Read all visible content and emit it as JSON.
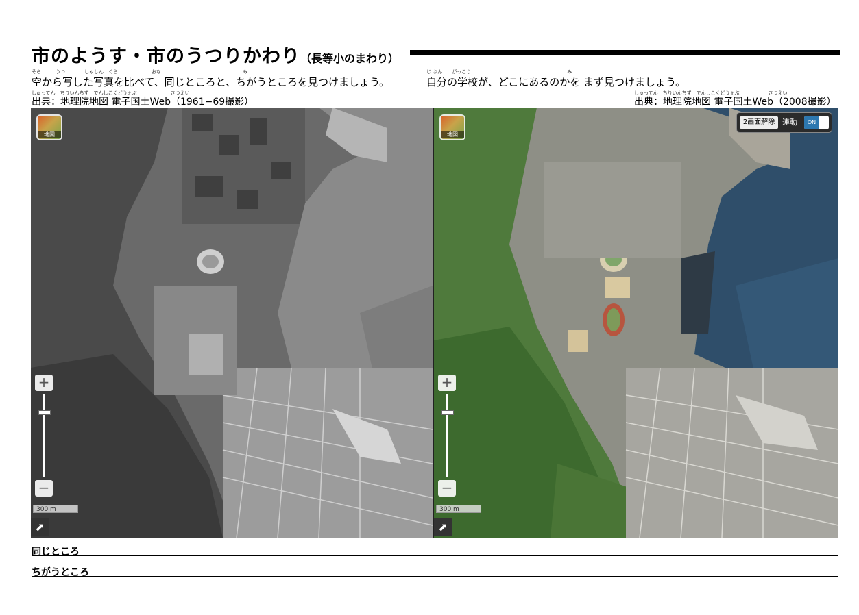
{
  "header": {
    "title": "市のようす・市のうつりかわり",
    "title_sub": "（長等小のまわり）"
  },
  "instructions": {
    "left_ruby": "そら　　　うつ　　　　しゃしん　くら　　　　　　　おな　　　　　　　　　　　　　　　　　み",
    "left": "空から写した写真を比べて、同じところと、ちがうところを見つけましょう。",
    "right_ruby": "じ ぶん　　がっこう　　　　　　　　　　　　　　　　　　　　み",
    "right": "自分の学校が、どこにあるのかを まず見つけましょう。"
  },
  "sources": {
    "left_ruby": "しゅってん　ちりいんちず　でんしこくどうぇぶ　　　　　　　さつえい",
    "left": "出典：地理院地図 電子国土Web（1961−69撮影）",
    "right_ruby": "しゅってん　ちりいんちず　でんしこくどうぇぶ　　　　　　さつえい",
    "right": "出典：地理院地図 電子国土Web（2008撮影）"
  },
  "maps": {
    "chizu_label": "地図",
    "zoom_in": "+",
    "zoom_out": "−",
    "scale_label": "300 m",
    "expand_icon": "⬈",
    "sync": {
      "unsplit_label": "2画面解除",
      "sync_label": "連動",
      "toggle_state": "ON"
    }
  },
  "answers": {
    "same": "同じところ",
    "different": "ちがうところ"
  }
}
